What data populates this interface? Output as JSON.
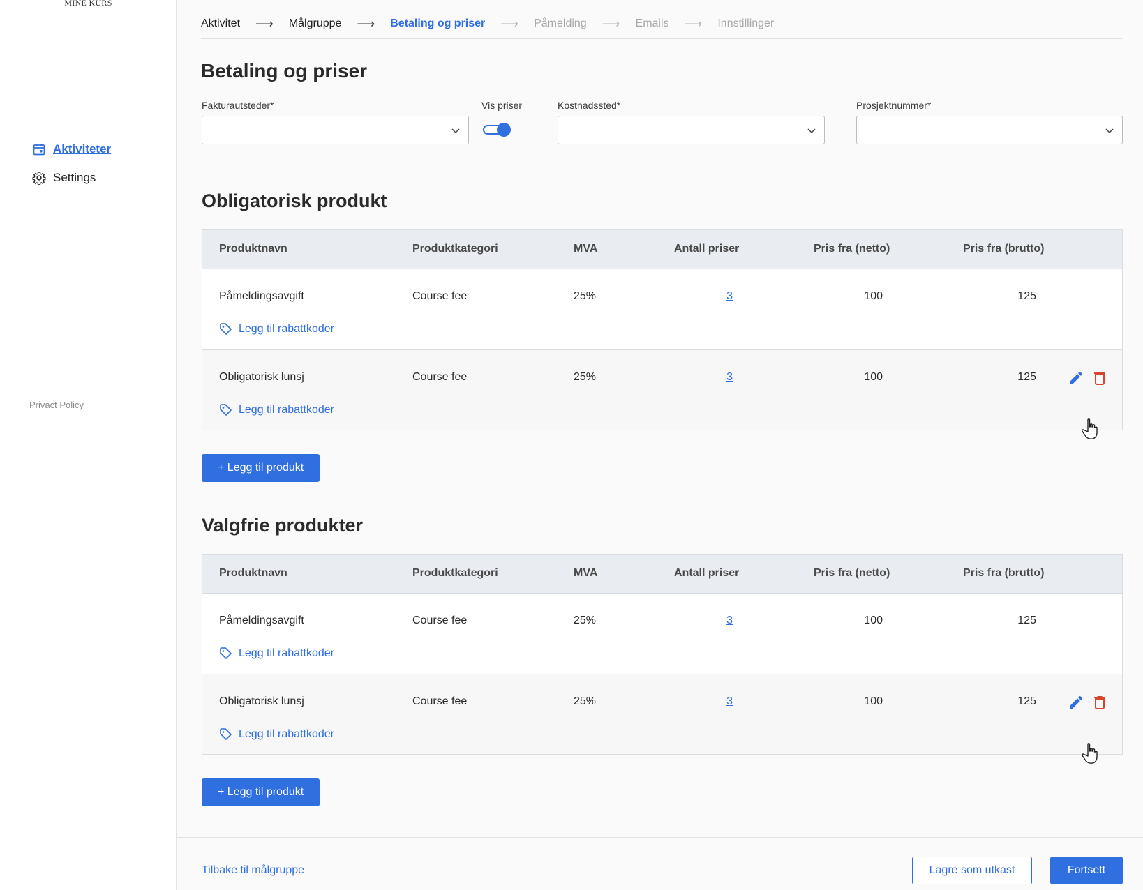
{
  "app": {
    "logo_text": "MINE KURS"
  },
  "sidebar": {
    "items": [
      {
        "label": "Aktiviteter",
        "icon": "calendar-icon"
      },
      {
        "label": "Settings",
        "icon": "gear-icon"
      }
    ],
    "privacy": "Privact Policy"
  },
  "steps": [
    {
      "label": "Aktivitet",
      "state": "done"
    },
    {
      "label": "Målgruppe",
      "state": "done"
    },
    {
      "label": "Betaling og priser",
      "state": "current"
    },
    {
      "label": "Påmelding",
      "state": "todo"
    },
    {
      "label": "Emails",
      "state": "todo"
    },
    {
      "label": "Innstillinger",
      "state": "todo"
    }
  ],
  "page": {
    "title": "Betaling og priser"
  },
  "form": {
    "fakturautsteder_label": "Fakturautsteder*",
    "fakturautsteder_value": "",
    "vis_priser_label": "Vis priser",
    "vis_priser_on": true,
    "kostnadssted_label": "Kostnadssted*",
    "kostnadssted_value": "",
    "prosjektnummer_label": "Prosjektnummer*",
    "prosjektnummer_value": ""
  },
  "columns": [
    "Produktnavn",
    "Produktkategori",
    "MVA",
    "Antall priser",
    "Pris fra (netto)",
    "Pris fra (brutto)"
  ],
  "discount_label": "Legg til rabattkoder",
  "add_product_label": "+ Legg til produkt",
  "mandatory": {
    "title": "Obligatorisk produkt",
    "rows": [
      {
        "name": "Påmeldingsavgift",
        "category": "Course fee",
        "vat": "25%",
        "price_count": "3",
        "net": "100",
        "gross": "125"
      },
      {
        "name": "Obligatorisk lunsj",
        "category": "Course fee",
        "vat": "25%",
        "price_count": "3",
        "net": "100",
        "gross": "125"
      }
    ]
  },
  "optional": {
    "title": "Valgfrie produkter",
    "rows": [
      {
        "name": "Påmeldingsavgift",
        "category": "Course fee",
        "vat": "25%",
        "price_count": "3",
        "net": "100",
        "gross": "125"
      },
      {
        "name": "Obligatorisk lunsj",
        "category": "Course fee",
        "vat": "25%",
        "price_count": "3",
        "net": "100",
        "gross": "125"
      }
    ]
  },
  "footer": {
    "back": "Tilbake til målgruppe",
    "draft": "Lagre som utkast",
    "continue": "Fortsett"
  },
  "colors": {
    "accent": "#2f6fe0",
    "danger": "#d8452a"
  }
}
